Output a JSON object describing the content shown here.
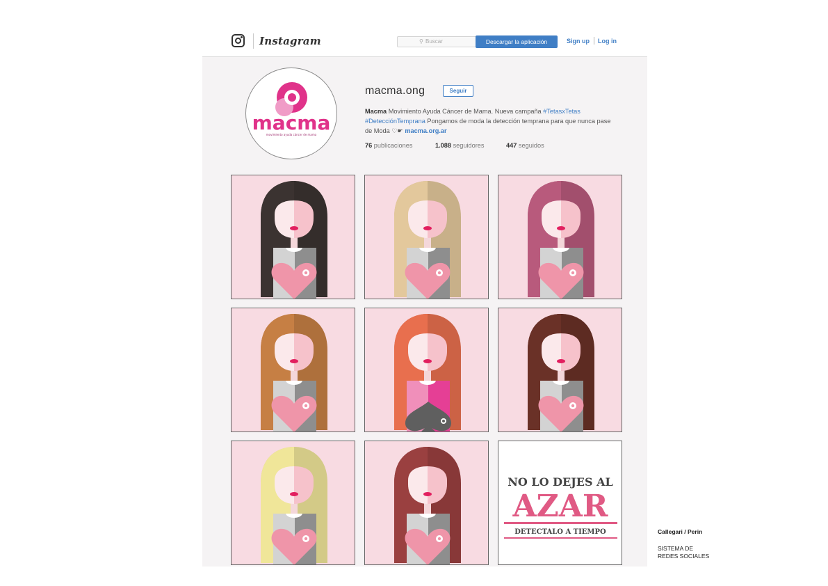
{
  "header": {
    "brand": "Instagram",
    "search_placeholder": "Buscar",
    "download_label": "Descargar la aplicación",
    "signup_label": "Sign up",
    "login_label": "Log in"
  },
  "profile": {
    "logo_text": "macma",
    "logo_tagline": "movimiento ayuda cáncer de mama",
    "username": "macma.ong",
    "follow_label": "Seguir",
    "bio": {
      "name": "Macma",
      "text1": " Movimiento Ayuda Cáncer de Mama. Nueva campaña ",
      "tag1": "#TetasxTetas",
      "tag2": "#DetecciónTemprana",
      "text2": " Pongamos de moda la detección temprana para que nunca pase de Moda ",
      "link": "macma.org.ar"
    },
    "stats": {
      "posts_count": "76",
      "posts_label": "publicaciones",
      "followers_count": "1.088",
      "followers_label": "seguidores",
      "following_count": "447",
      "following_label": "seguidos"
    }
  },
  "posts": [
    {
      "type": "woman",
      "hair": "#3b3331",
      "symbol": "heart"
    },
    {
      "type": "woman",
      "hair": "#e3c89c",
      "symbol": "heart"
    },
    {
      "type": "woman",
      "hair": "#b85a7c",
      "symbol": "heart"
    },
    {
      "type": "woman",
      "hair": "#c67f44",
      "symbol": "heart"
    },
    {
      "type": "woman",
      "hair": "#e86f4e",
      "symbol": "spade"
    },
    {
      "type": "woman",
      "hair": "#6a3127",
      "symbol": "heart"
    },
    {
      "type": "woman",
      "hair": "#f0e699",
      "symbol": "heart"
    },
    {
      "type": "woman",
      "hair": "#9a4040",
      "symbol": "heart"
    },
    {
      "type": "text"
    }
  ],
  "campaign": {
    "line1": "NO LO DEJES AL",
    "line2": "AZAR",
    "line3": "DETECTALO A TIEMPO"
  },
  "colors": {
    "accent_blue": "#3f7ec5",
    "brand_pink": "#e0338a",
    "tile_bg": "#f8dbe2",
    "heart": "#ef95a9",
    "campaign_pink": "#e05a84"
  },
  "footer": {
    "credit": "Callegari / Perin",
    "caption_line1": "SISTEMA DE",
    "caption_line2": "REDES SOCIALES"
  }
}
